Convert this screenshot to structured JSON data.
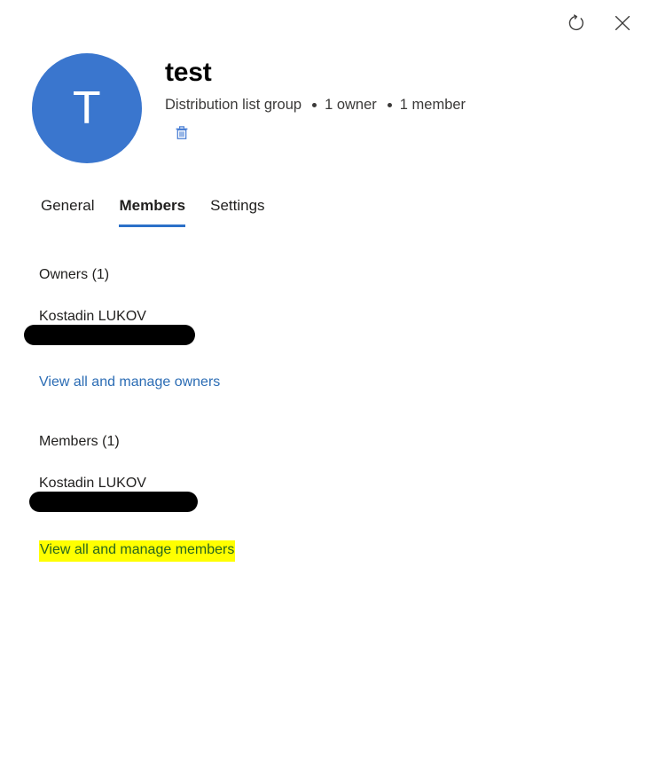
{
  "window": {
    "refresh_label": "Refresh",
    "refresh_icon": "refresh-icon",
    "close_label": "Close",
    "close_icon": "close-icon"
  },
  "header": {
    "avatar_initial": "T",
    "avatar_color": "#3a76ce",
    "title": "test",
    "group_type": "Distribution list group",
    "owner_count_label": "1 owner",
    "member_count_label": "1 member",
    "delete_icon": "trash-icon",
    "delete_label": "Delete group",
    "delete_icon_color": "#4a7fd4"
  },
  "tabs": {
    "active_index": 1,
    "accent_color": "#2b70c8",
    "items": [
      {
        "label": "General"
      },
      {
        "label": "Members"
      },
      {
        "label": "Settings"
      }
    ]
  },
  "members_tab": {
    "owners": {
      "section_title": "Owners (1)",
      "people": [
        {
          "name": "Kostadin LUKOV",
          "detail_redacted": true
        }
      ],
      "link_label": "View all and manage owners"
    },
    "members": {
      "section_title": "Members (1)",
      "people": [
        {
          "name": "Kostadin LUKOV",
          "detail_redacted": true
        }
      ],
      "link_label": "View all and manage members",
      "link_highlight_color": "#ffff00"
    }
  }
}
